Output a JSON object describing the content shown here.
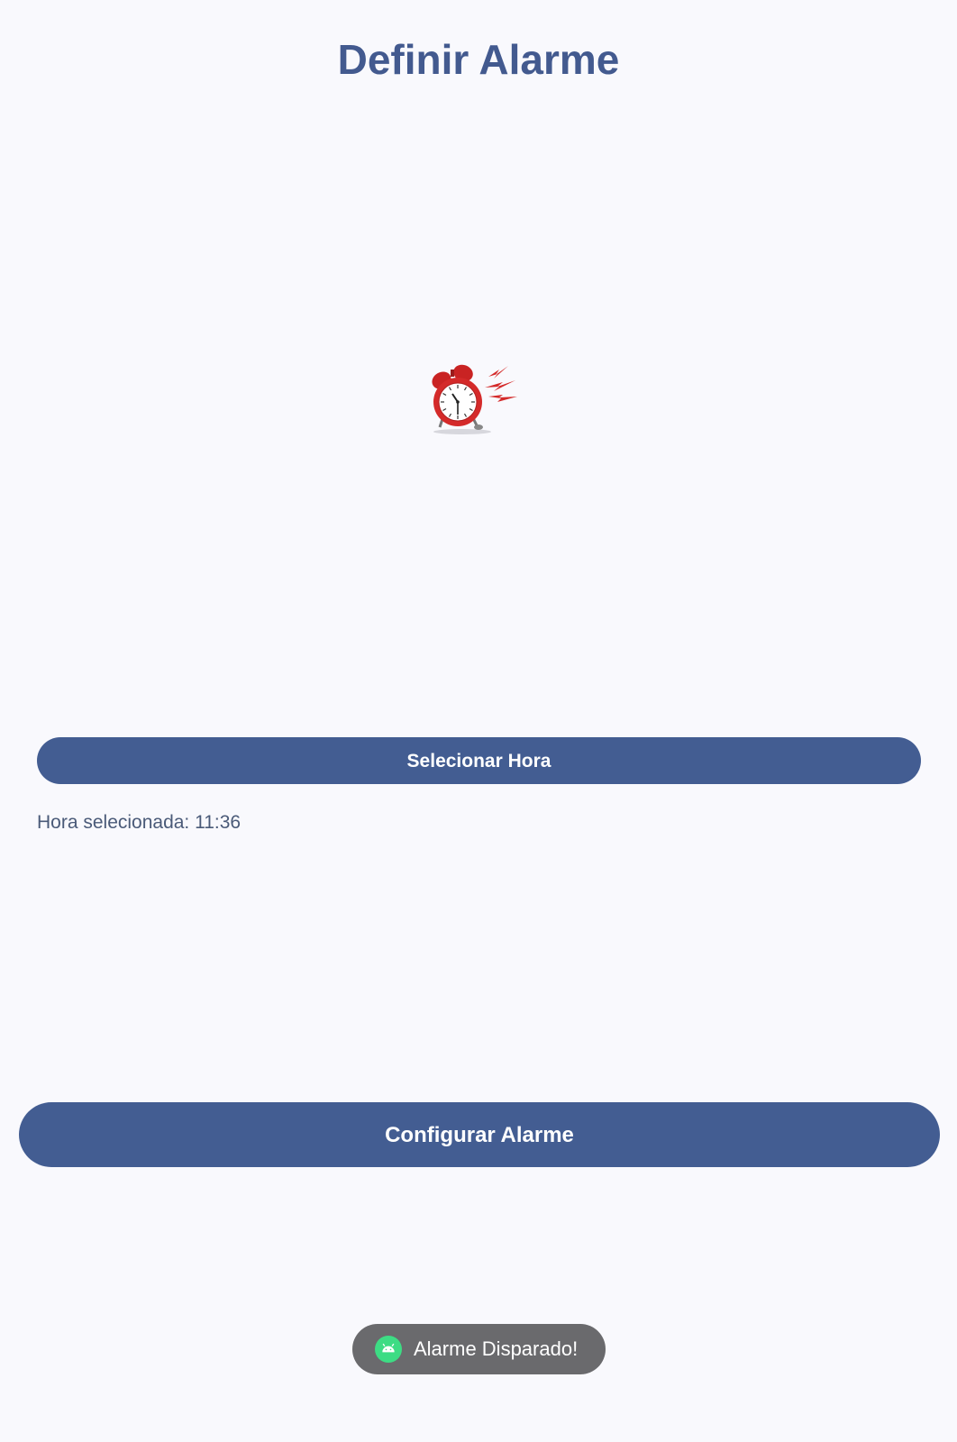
{
  "header": {
    "title": "Definir Alarme"
  },
  "hero": {
    "icon": "alarm-clock-icon"
  },
  "time_picker": {
    "button_label": "Selecionar Hora",
    "selected_text": "Hora selecionada: 11:36"
  },
  "actions": {
    "configure_label": "Configurar Alarme"
  },
  "toast": {
    "icon": "android-icon",
    "message": "Alarme Disparado!"
  },
  "colors": {
    "background": "#f9f9fd",
    "primary": "#435d92",
    "title": "#435a8f",
    "toast_bg": "#6a6a6d",
    "clock_red": "#d42a2a"
  }
}
